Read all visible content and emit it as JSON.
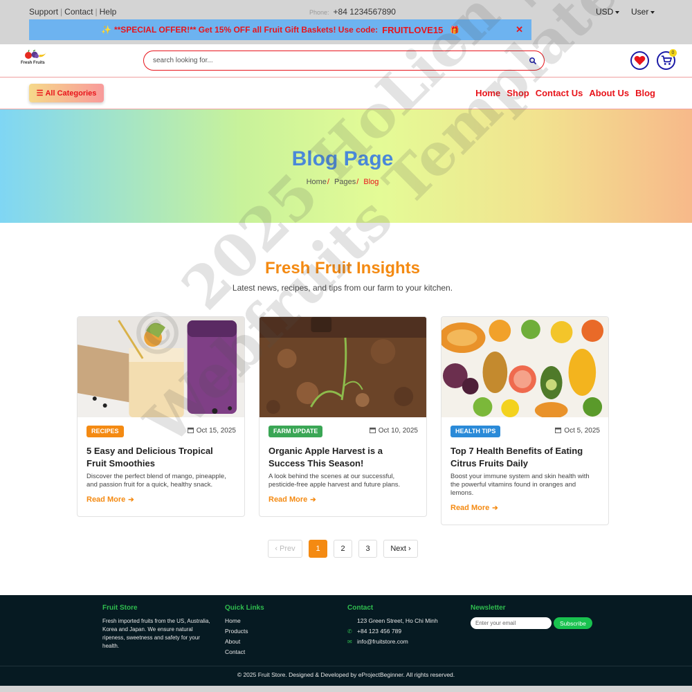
{
  "topbar": {
    "support": "Support",
    "contact": "Contact",
    "help": "Help",
    "sep": "|",
    "phone_label": "Phone:",
    "phone": "+84 1234567890",
    "currency": "USD",
    "user": "User"
  },
  "promo": {
    "sparkle": "✨",
    "text": "**SPECIAL OFFER!** Get 15% OFF all Fruit Gift Baskets! Use code:",
    "code": "FRUITLOVE15",
    "gift": "🎁",
    "close": "✕"
  },
  "header": {
    "logo_text": "Fresh Fruits",
    "search_placeholder": "search looking for...",
    "cart_count": "0"
  },
  "nav": {
    "categories": "All Categories",
    "menu": [
      "Home",
      "Shop",
      "Contact Us",
      "About Us",
      "Blog"
    ]
  },
  "hero": {
    "title": "Blog Page",
    "breadcrumb": [
      "Home",
      "Pages",
      "Blog"
    ],
    "separator": "/"
  },
  "blog": {
    "title": "Fresh Fruit Insights",
    "subtitle": "Latest news, recipes, and tips from our farm to your kitchen.",
    "read_more": "Read More",
    "posts": [
      {
        "tag": "RECIPES",
        "tag_color": "#f48a12",
        "date": "Oct 15, 2025",
        "title": "5 Easy and Delicious Tropical Fruit Smoothies",
        "excerpt": "Discover the perfect blend of mango, pineapple, and passion fruit for a quick, healthy snack."
      },
      {
        "tag": "FARM UPDATE",
        "tag_color": "#3aa655",
        "date": "Oct 10, 2025",
        "title": "Organic Apple Harvest is a Success This Season!",
        "excerpt": "A look behind the scenes at our successful, pesticide-free apple harvest and future plans."
      },
      {
        "tag": "HEALTH TIPS",
        "tag_color": "#2a8ad8",
        "date": "Oct 5, 2025",
        "title": "Top 7 Health Benefits of Eating Citrus Fruits Daily",
        "excerpt": "Boost your immune system and skin health with the powerful vitamins found in oranges and lemons."
      }
    ]
  },
  "pagination": {
    "prev": "‹ Prev",
    "pages": [
      "1",
      "2",
      "3"
    ],
    "next": "Next ›",
    "current": 1
  },
  "footer": {
    "store_title": "Fruit Store",
    "store_text": "Fresh imported fruits from the US, Australia, Korea and Japan. We ensure natural ripeness, sweetness and safety for your health.",
    "links_title": "Quick Links",
    "links": [
      "Home",
      "Products",
      "About",
      "Contact"
    ],
    "contact_title": "Contact",
    "address": "123 Green Street, Ho Chi Minh",
    "phone": "+84 123 456 789",
    "email": "info@fruitstore.com",
    "newsletter_title": "Newsletter",
    "email_placeholder": "Enter your email",
    "subscribe": "Subscribe",
    "copyright": "© 2025 Fruit Store. Designed & Developed by eProjectBeginner. All rights reserved."
  },
  "watermark": {
    "line1": "© 2025 HoLien |",
    "line2": "Webfruits Template"
  },
  "colors": {
    "brand_red": "#e8141b",
    "accent_orange": "#f48a12",
    "hero_title": "#4a88d8",
    "footer_bg": "#061a22",
    "footer_green": "#2fbe4f"
  }
}
